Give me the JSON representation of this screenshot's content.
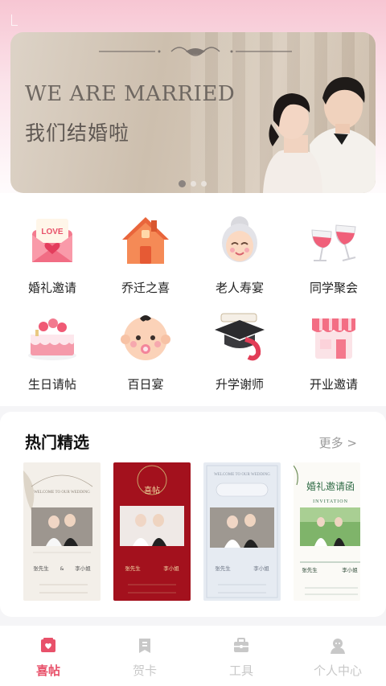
{
  "banner": {
    "headline_en": "WE ARE MARRIED",
    "headline_zh": "我们结婚啦",
    "slide_count": 3,
    "active_slide": 1
  },
  "categories": [
    {
      "label": "婚礼邀请",
      "icon": "love-envelope-icon"
    },
    {
      "label": "乔迁之喜",
      "icon": "house-icon"
    },
    {
      "label": "老人寿宴",
      "icon": "grandma-icon"
    },
    {
      "label": "同学聚会",
      "icon": "wine-glasses-icon"
    },
    {
      "label": "生日请帖",
      "icon": "birthday-cake-icon"
    },
    {
      "label": "百日宴",
      "icon": "baby-icon"
    },
    {
      "label": "升学谢师",
      "icon": "graduation-cap-icon"
    },
    {
      "label": "开业邀请",
      "icon": "storefront-icon"
    }
  ],
  "hot": {
    "title": "热门精选",
    "more": "更多 >"
  },
  "cards": [
    {
      "style": "cream",
      "name_left": "张先生",
      "name_mid": "&",
      "name_right": "李小姐"
    },
    {
      "style": "red",
      "heading": "喜帖",
      "name_left": "张先生",
      "name_right": "李小姐"
    },
    {
      "style": "light-blue",
      "name_left": "张先生",
      "name_right": "李小姐"
    },
    {
      "style": "green",
      "heading": "婚礼邀请函",
      "subheading": "INVITATION",
      "name_left": "张先生",
      "name_right": "李小姐"
    }
  ],
  "tabs": [
    {
      "label": "喜帖",
      "icon": "invitation-icon",
      "active": true
    },
    {
      "label": "贺卡",
      "icon": "card-icon",
      "active": false
    },
    {
      "label": "工具",
      "icon": "toolbox-icon",
      "active": false
    },
    {
      "label": "个人中心",
      "icon": "user-icon",
      "active": false
    }
  ],
  "colors": {
    "accent": "#e8516a",
    "tab_inactive": "#c8c8c8",
    "banner_text": "#6e6761"
  }
}
